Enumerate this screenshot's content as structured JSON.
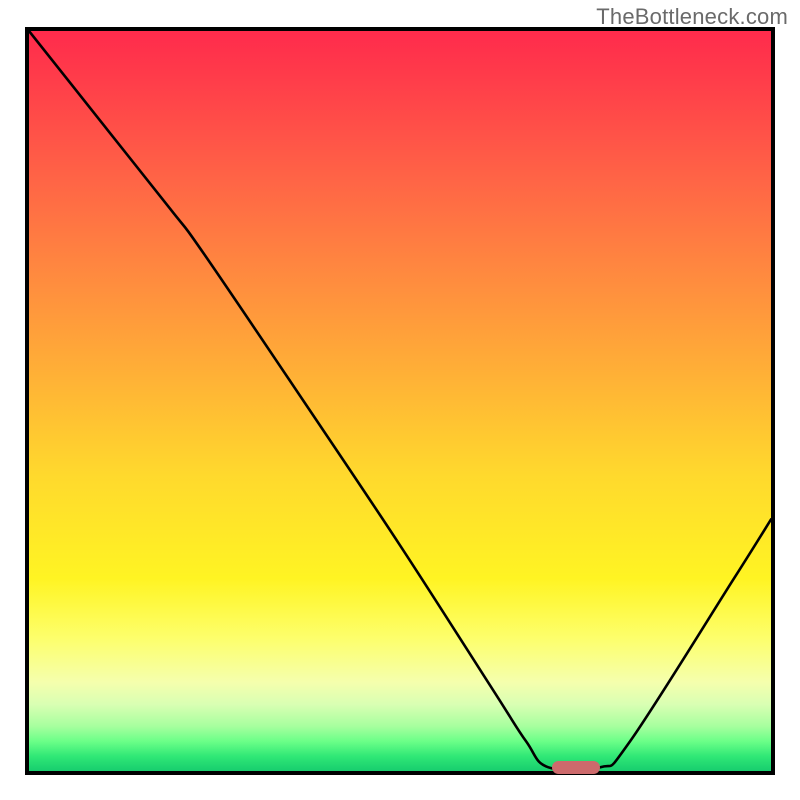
{
  "watermark": "TheBottleneck.com",
  "chart_data": {
    "type": "line",
    "title": "",
    "xlabel": "",
    "ylabel": "",
    "xlim": [
      0,
      100
    ],
    "ylim": [
      0,
      100
    ],
    "grid": false,
    "curve": {
      "x": [
        0.0,
        9.5,
        19.0,
        23.5,
        37.0,
        50.0,
        62.5,
        67.0,
        70.0,
        77.0,
        81.0,
        95.0,
        100.0
      ],
      "y": [
        100.0,
        88.0,
        76.0,
        70.0,
        50.0,
        30.5,
        11.0,
        4.0,
        0.5,
        0.5,
        4.0,
        26.0,
        34.0
      ]
    },
    "marker": {
      "x_start": 70.5,
      "x_end": 77.0,
      "y": 0.5,
      "color": "#cd6a6c"
    },
    "gradient_colors": {
      "top": "#ff2b4c",
      "mid": "#ffd92d",
      "bottom": "#17cd6e"
    }
  }
}
